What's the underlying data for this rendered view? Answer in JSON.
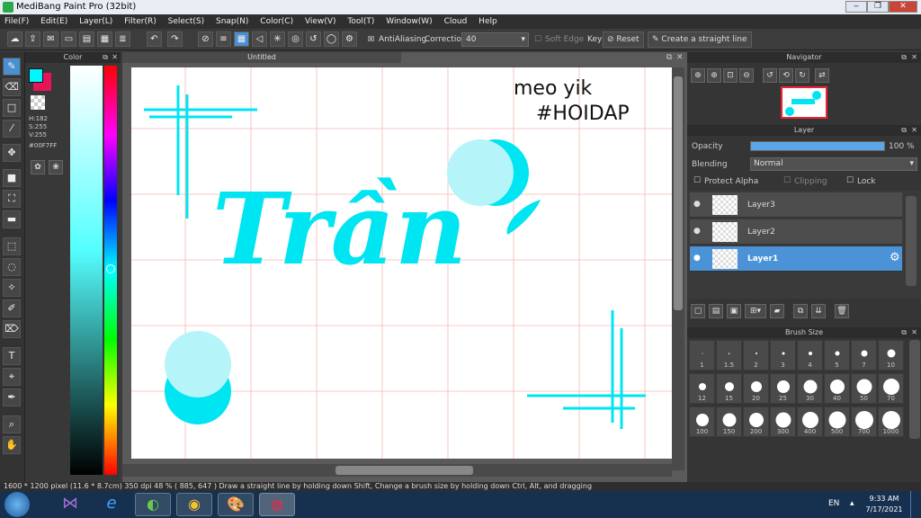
{
  "window": {
    "title": "MediBang Paint Pro (32bit)"
  },
  "menu": [
    "File(F)",
    "Edit(E)",
    "Layer(L)",
    "Filter(R)",
    "Select(S)",
    "Snap(N)",
    "Color(C)",
    "View(V)",
    "Tool(T)",
    "Window(W)",
    "Cloud",
    "Help"
  ],
  "toolbar": {
    "antialiasing_label": "AntiAliasing",
    "correction_label": "Correction",
    "correction_value": "40",
    "soft_edge_label": "Soft Edge",
    "key_label": "Key",
    "reset_label": "Reset",
    "straight_line_label": "Create a straight line"
  },
  "color_panel": {
    "title": "Color",
    "h": "H:182",
    "s": "S:255",
    "v": "V:255",
    "hex": "#00F7FF",
    "foreground": "#00f7ff",
    "background": "#e8145a"
  },
  "document": {
    "tab": "Untitled"
  },
  "artwork": {
    "word": "Trần",
    "watermark_line1": "meo yik",
    "watermark_line2": "#HOIDAP",
    "accent": "#00e5f2",
    "light": "#b5f4f8"
  },
  "navigator": {
    "title": "Navigator"
  },
  "layer_panel": {
    "title": "Layer",
    "opacity_label": "Opacity",
    "opacity_value": "100 %",
    "opacity_fraction": 1.0,
    "blending_label": "Blending",
    "blending_value": "Normal",
    "protect_alpha_label": "Protect Alpha",
    "clipping_label": "Clipping",
    "lock_label": "Lock",
    "layers": [
      {
        "name": "Layer3",
        "selected": false
      },
      {
        "name": "Layer2",
        "selected": false
      },
      {
        "name": "Layer1",
        "selected": true
      }
    ]
  },
  "brush_panel": {
    "title": "Brush Size",
    "sizes": [
      "1",
      "1.5",
      "2",
      "3",
      "4",
      "5",
      "7",
      "10",
      "12",
      "15",
      "20",
      "25",
      "30",
      "40",
      "50",
      "70",
      "100",
      "150",
      "200",
      "300",
      "400",
      "500",
      "700",
      "1000"
    ]
  },
  "status": {
    "text": "1600 * 1200 pixel   (11.6 * 8.7cm)   350 dpi   48 %   ( 885, 647 )   Draw a straight line by holding down Shift, Change a brush size by holding down Ctrl, Alt, and dragging"
  },
  "taskbar": {
    "lang": "EN",
    "time": "9:33 AM",
    "date": "7/17/2021"
  }
}
